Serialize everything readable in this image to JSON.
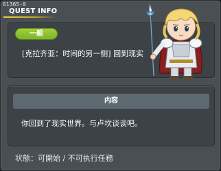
{
  "window": {
    "quest_id": "61365-0",
    "title": "QUEST INFO"
  },
  "quest": {
    "category": "一般",
    "name": "[克拉齐亚：时间的另一侧] 回到现实"
  },
  "content": {
    "header": "内容",
    "text": "你回到了现实世界。与卢坎谈谈吧。"
  },
  "status": {
    "text": "状態：可開始 / 不可执行任務"
  },
  "colors": {
    "title_underline": "#f2d33a",
    "category_pill": "#8fc232",
    "panel": "#3d4246",
    "window": "#4a4f53"
  },
  "icons": [
    "npc-character-portrait",
    "spear-icon"
  ]
}
